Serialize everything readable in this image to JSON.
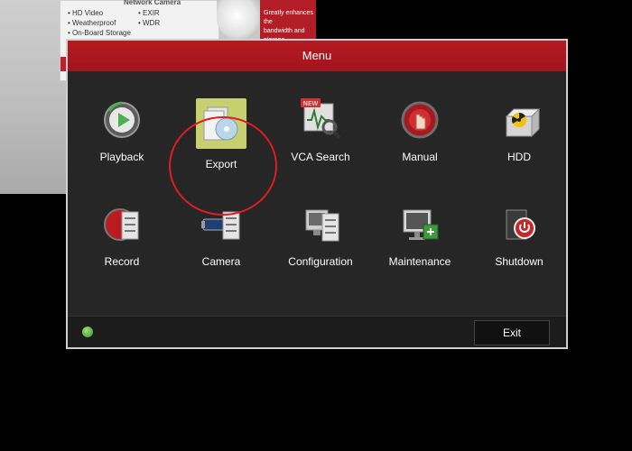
{
  "background": {
    "box_header": "Network Camera",
    "box_text_col1": [
      "• HD Video",
      "• Weatherproof",
      "• On-Board Storage"
    ],
    "box_text_col2": [
      "• EXIR",
      "• WDR"
    ],
    "red_box_text": [
      "Greatly enhances the",
      "bandwidth and storage"
    ]
  },
  "menu": {
    "title": "Menu",
    "items": [
      {
        "label": "Playback",
        "icon": "playback-icon"
      },
      {
        "label": "Export",
        "icon": "export-icon",
        "selected": true
      },
      {
        "label": "VCA Search",
        "icon": "vca-search-icon",
        "badge": "NEW"
      },
      {
        "label": "Manual",
        "icon": "manual-icon"
      },
      {
        "label": "HDD",
        "icon": "hdd-icon"
      },
      {
        "label": "Record",
        "icon": "record-icon"
      },
      {
        "label": "Camera",
        "icon": "camera-icon"
      },
      {
        "label": "Configuration",
        "icon": "configuration-icon"
      },
      {
        "label": "Maintenance",
        "icon": "maintenance-icon"
      },
      {
        "label": "Shutdown",
        "icon": "shutdown-icon"
      }
    ],
    "exit_label": "Exit"
  },
  "colors": {
    "title_bar": "#b61a22",
    "panel": "#262626",
    "highlight_ring": "#e01c24",
    "export_selected_bg": "#c8cf6e"
  }
}
